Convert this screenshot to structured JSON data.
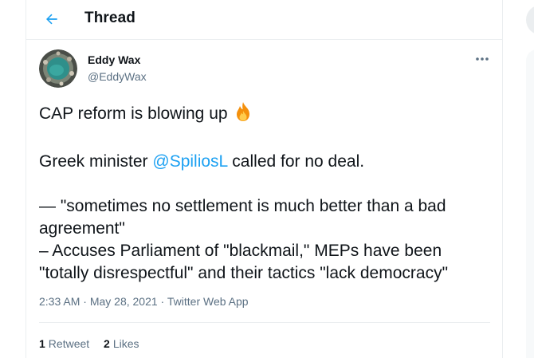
{
  "header": {
    "title": "Thread"
  },
  "tweet": {
    "author_name": "Eddy Wax",
    "author_handle": "@EddyWax",
    "line1": "CAP reform is blowing up",
    "line2_before": "Greek minister ",
    "mention": "@SpiliosL",
    "line2_after": " called for no deal.",
    "line3": "— \"sometimes no settlement is much better than a bad",
    "line4": "agreement\"",
    "line5": "– Accuses  Parliament of \"blackmail,\" MEPs have been",
    "line6": "\"totally disrespectful\" and their tactics \"lack democracy\"",
    "time": "2:33 AM",
    "date": "May 28, 2021",
    "source": "Twitter Web App",
    "separator": " · "
  },
  "stats": {
    "retweets_count": "1",
    "retweets_label": "Retweet",
    "likes_count": "2",
    "likes_label": "Likes"
  },
  "colors": {
    "accent": "#1da1f2",
    "secondary_text": "#5b7083",
    "border": "#ebeef0"
  },
  "icons": {
    "back": "back-arrow-icon",
    "more": "more-horizontal-icon",
    "emoji": "fire-icon"
  }
}
